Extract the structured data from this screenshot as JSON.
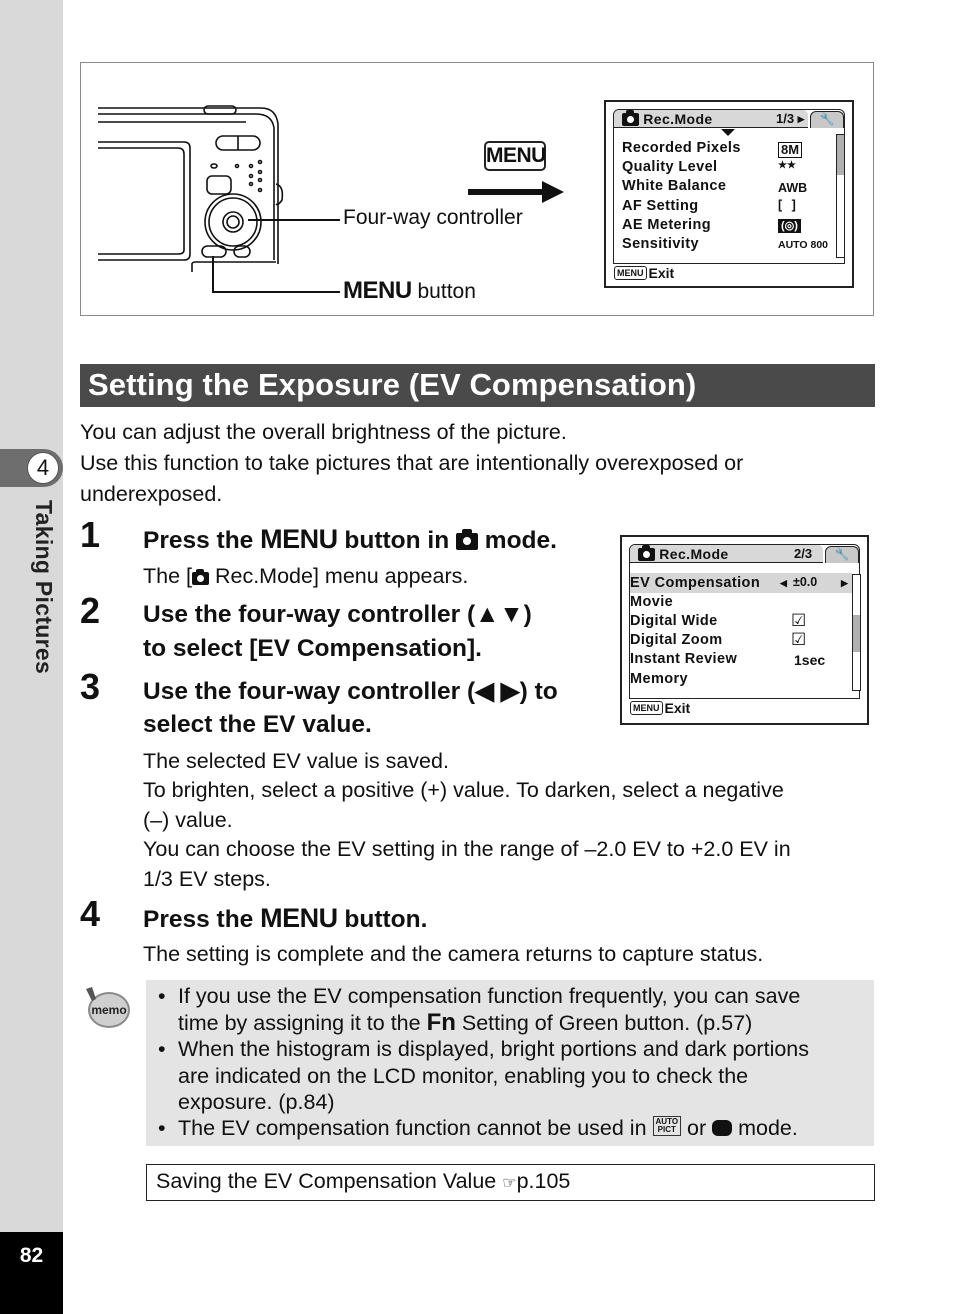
{
  "sidebar": {
    "chapter_number": "4",
    "chapter_title": "Taking Pictures",
    "page_number": "82"
  },
  "figure": {
    "menu_key_label": "MENU",
    "callout_four_way": "Four-way controller",
    "callout_menu_bold": "MENU",
    "callout_menu_rest": " button",
    "screen1": {
      "tab_label": "Rec.Mode",
      "page": "1/3",
      "rows": [
        {
          "label": "Recorded Pixels",
          "value": "8M"
        },
        {
          "label": "Quality Level",
          "value": "★★"
        },
        {
          "label": "White Balance",
          "value": "AWB"
        },
        {
          "label": "AF Setting",
          "value": "[ ]"
        },
        {
          "label": "AE Metering",
          "value": "(◎)"
        },
        {
          "label": "Sensitivity",
          "value": "AUTO 800"
        }
      ],
      "exit_key": "MENU",
      "exit_label": "Exit"
    }
  },
  "section": {
    "title": "Setting the Exposure (EV Compensation)",
    "intro_line1": "You can adjust the overall brightness of the picture.",
    "intro_line2": "Use this function to take pictures that are intentionally overexposed or",
    "intro_line3": "underexposed."
  },
  "steps": [
    {
      "num": "1",
      "head_a": "Press the ",
      "head_menu": "MENU",
      "head_b": " button in ",
      "head_c": " mode.",
      "text_a": "The [",
      "text_b": " Rec.Mode] menu appears."
    },
    {
      "num": "2",
      "head_line1": "Use the four-way controller (▲▼)",
      "head_line2": "to select [EV Compensation]."
    },
    {
      "num": "3",
      "head_line1": "Use the four-way controller (◀ ▶) to",
      "head_line2": "select the EV value.",
      "text_line1": "The selected EV value is saved.",
      "text_line2": "To brighten, select a positive (+) value. To darken, select a negative",
      "text_line3": "(–) value.",
      "text_line4": "You can choose the EV setting in the range of –2.0 EV to +2.0 EV in",
      "text_line5": "1/3 EV steps."
    },
    {
      "num": "4",
      "head_a": "Press the ",
      "head_menu": "MENU",
      "head_b": " button.",
      "text": "The setting is complete and the camera returns to capture status."
    }
  ],
  "screen2": {
    "tab_label": "Rec.Mode",
    "page": "2/3",
    "rows": [
      {
        "label": "EV Compensation",
        "value": "±0.0",
        "selected": true
      },
      {
        "label": "Movie",
        "value": ""
      },
      {
        "label": "Digital Wide",
        "value": "☑"
      },
      {
        "label": "Digital Zoom",
        "value": "☑"
      },
      {
        "label": "Instant Review",
        "value": "1sec"
      },
      {
        "label": "Memory",
        "value": ""
      }
    ],
    "exit_key": "MENU",
    "exit_label": "Exit"
  },
  "memo": {
    "icon_label": "memo",
    "items": [
      {
        "a": "If you use the EV compensation function frequently, you can save",
        "b1": "time by assigning it to the ",
        "b_bold": "Fn",
        "b2": " Setting of Green button. (p.57)"
      },
      {
        "a": "When the histogram is displayed, bright portions and dark portions",
        "b": "are indicated on the LCD monitor, enabling you to check the",
        "c": "exposure. (p.84)"
      },
      {
        "a1": "The EV compensation function cannot be used in ",
        "auto_top": "AUTO",
        "auto_bottom": "PICT",
        "a2": " or ",
        "a3": " mode."
      }
    ]
  },
  "reference": {
    "text": "Saving the EV Compensation Value ",
    "pointer": "☞",
    "page": "p.105"
  }
}
